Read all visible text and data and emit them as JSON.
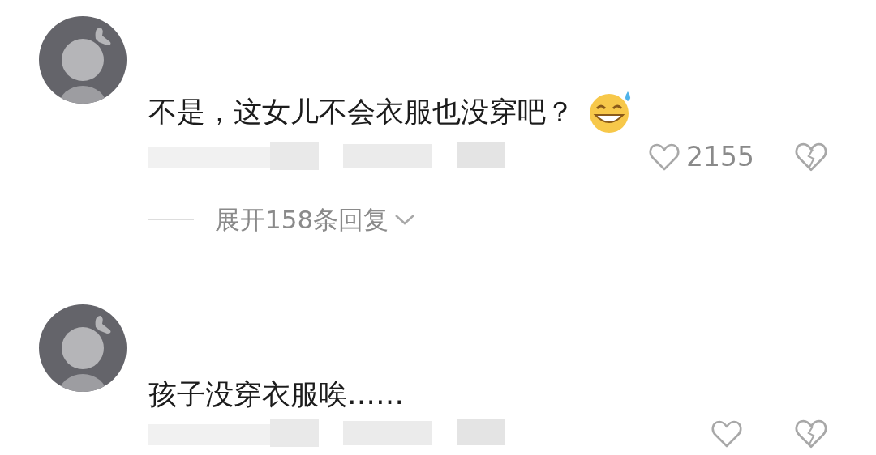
{
  "comments": [
    {
      "text": "不是，这女儿不会衣服也没穿吧？",
      "emoji": true,
      "like_count": "2155",
      "replies": "展开158条回复"
    },
    {
      "text": "孩子没穿衣服唉……",
      "emoji": false
    }
  ]
}
